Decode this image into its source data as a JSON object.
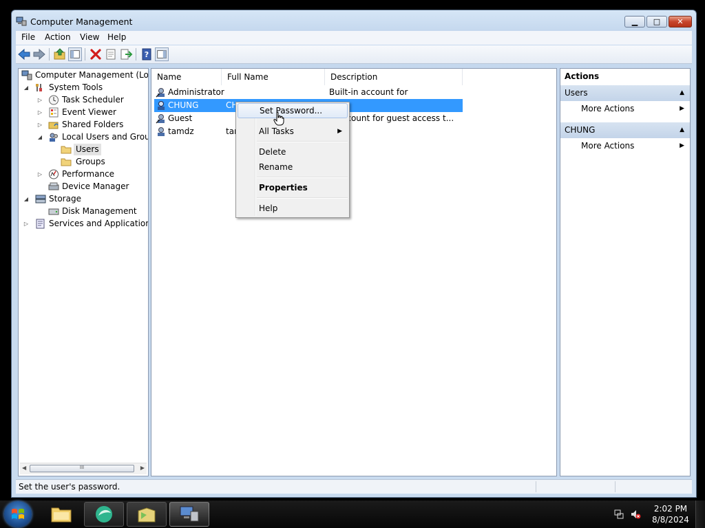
{
  "window": {
    "title": "Computer Management",
    "controls": {
      "minimize": "▁",
      "maximize": "□",
      "close": "✕"
    }
  },
  "menubar": [
    "File",
    "Action",
    "View",
    "Help"
  ],
  "tree": {
    "items": [
      {
        "label": "Computer Management (Local",
        "icon": "computer-management-icon",
        "expander": "none"
      },
      {
        "label": "System Tools",
        "icon": "system-tools-icon",
        "expander": "expanded"
      },
      {
        "label": "Task Scheduler",
        "icon": "clock-icon",
        "expander": "collapsed"
      },
      {
        "label": "Event Viewer",
        "icon": "event-viewer-icon",
        "expander": "collapsed"
      },
      {
        "label": "Shared Folders",
        "icon": "shared-folder-icon",
        "expander": "collapsed"
      },
      {
        "label": "Local Users and Groups",
        "icon": "users-icon",
        "expander": "expanded"
      },
      {
        "label": "Users",
        "icon": "folder-icon",
        "expander": "none",
        "selected": true
      },
      {
        "label": "Groups",
        "icon": "folder-icon",
        "expander": "none"
      },
      {
        "label": "Performance",
        "icon": "performance-icon",
        "expander": "collapsed"
      },
      {
        "label": "Device Manager",
        "icon": "device-manager-icon",
        "expander": "none"
      },
      {
        "label": "Storage",
        "icon": "storage-icon",
        "expander": "expanded"
      },
      {
        "label": "Disk Management",
        "icon": "disk-icon",
        "expander": "none"
      },
      {
        "label": "Services and Applications",
        "icon": "services-icon",
        "expander": "collapsed"
      }
    ],
    "scrollbar": {
      "left_arrow": "◀",
      "right_arrow": "▶",
      "grip": "III"
    }
  },
  "list": {
    "columns": [
      "Name",
      "Full Name",
      "Description"
    ],
    "rows": [
      {
        "name": "Administrator",
        "full_name": "",
        "description": "Built-in account for administering..."
      },
      {
        "name": "CHUNG",
        "full_name": "CH",
        "description": "",
        "selected": true
      },
      {
        "name": "Guest",
        "full_name": "",
        "description": "n account for guest access t..."
      },
      {
        "name": "tamdz",
        "full_name": "tan",
        "description": ""
      }
    ]
  },
  "actions": {
    "title": "Actions",
    "sections": [
      {
        "header": "Users",
        "items": [
          "More Actions"
        ]
      },
      {
        "header": "CHUNG",
        "items": [
          "More Actions"
        ]
      }
    ],
    "collapse_glyph": "▲",
    "submenu_glyph": "▶"
  },
  "context_menu": {
    "items": [
      "Set Password...",
      "All Tasks",
      "Delete",
      "Rename",
      "Properties",
      "Help"
    ],
    "submenu_glyph": "▶"
  },
  "statusbar": {
    "text": "Set the user's password."
  },
  "taskbar": {
    "time": "2:02 PM",
    "date": "8/8/2024"
  },
  "colors": {
    "selection": "#3399ff",
    "window_frame": "#c5d8ee",
    "taskbar": "#0a0a0a",
    "close_button": "#c7452c"
  }
}
